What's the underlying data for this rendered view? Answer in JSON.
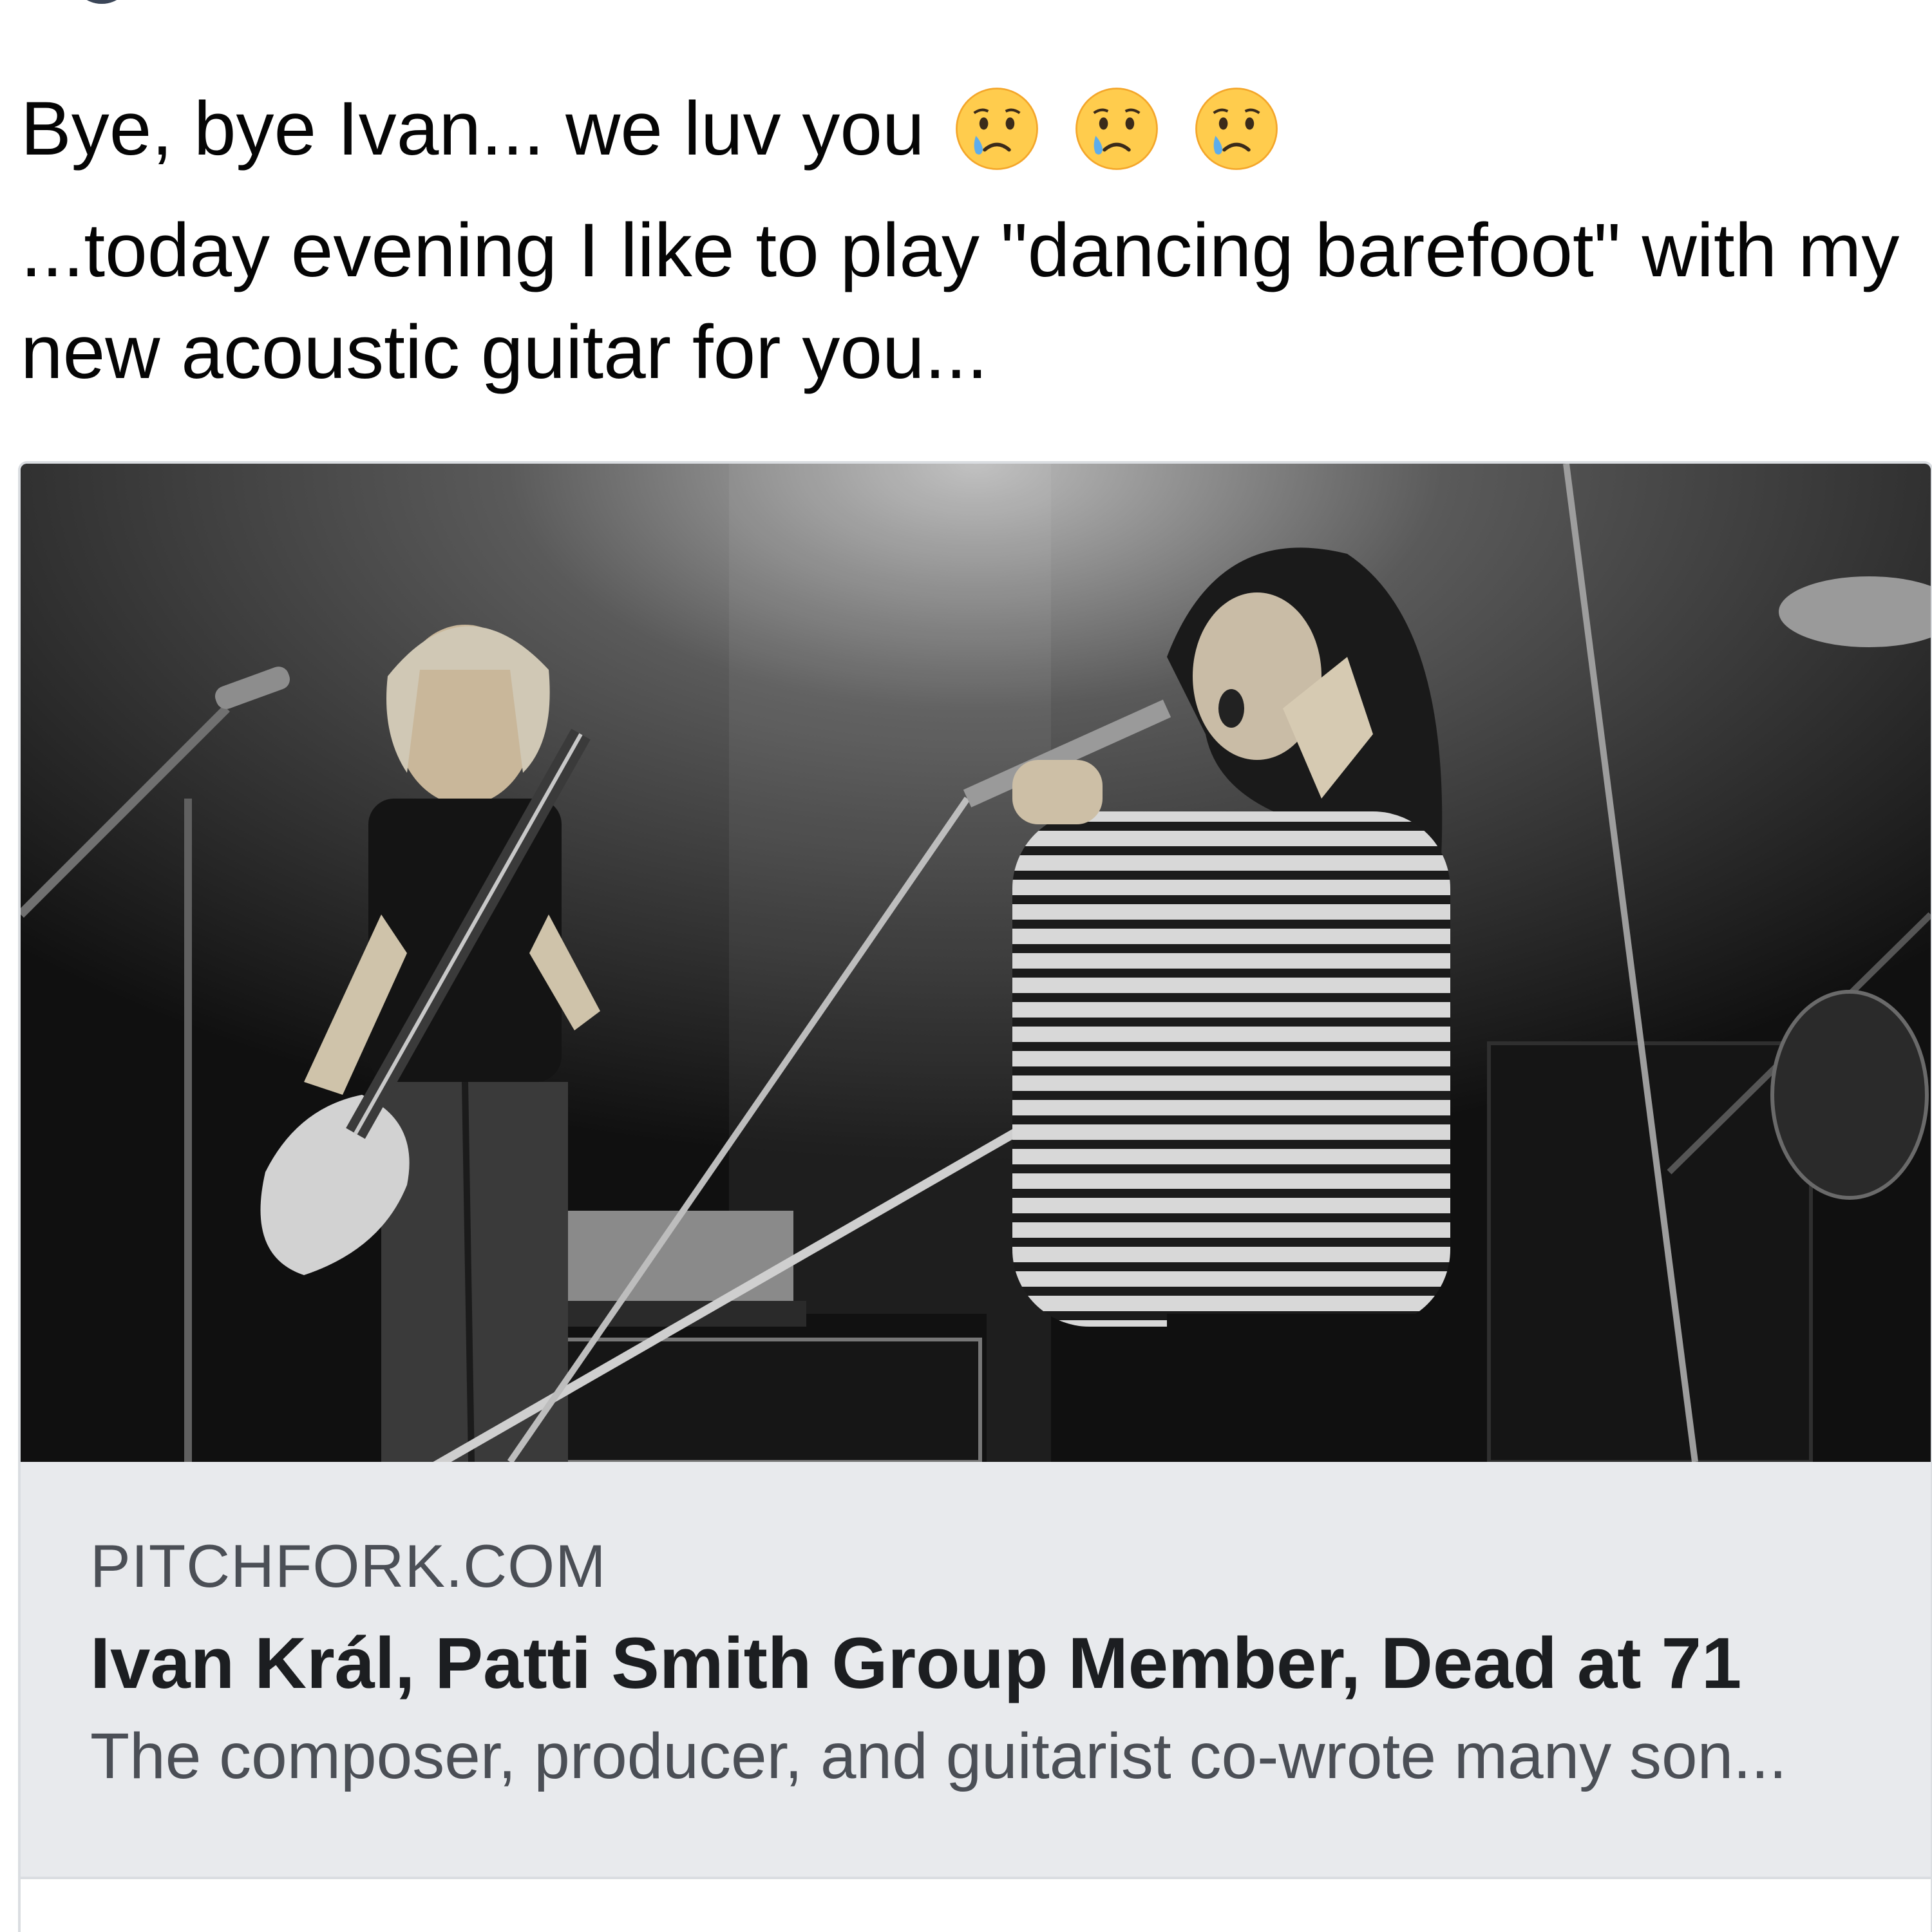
{
  "post": {
    "line1_text": "Bye, bye Ivan... we luv you",
    "line1_emojis": [
      "crying-face",
      "crying-face",
      "crying-face"
    ],
    "line2_text": "...today evening I like to play \"dancing barefoot\" with my new acoustic guitar for you..."
  },
  "link_card": {
    "image_alt": "Black and white concert photo of a guitarist and a singer at a microphone stand",
    "source": "PITCHFORK.COM",
    "headline": "Ivan Král, Patti Smith Group Member, Dead at 71",
    "description": "The composer, producer, and guitarist co-wrote many son..."
  },
  "colors": {
    "text_primary": "#050505",
    "card_meta_bg": "#e8eaed",
    "card_border": "#dadde1",
    "source_text": "#4b4f56",
    "headline_text": "#1c1e21"
  }
}
